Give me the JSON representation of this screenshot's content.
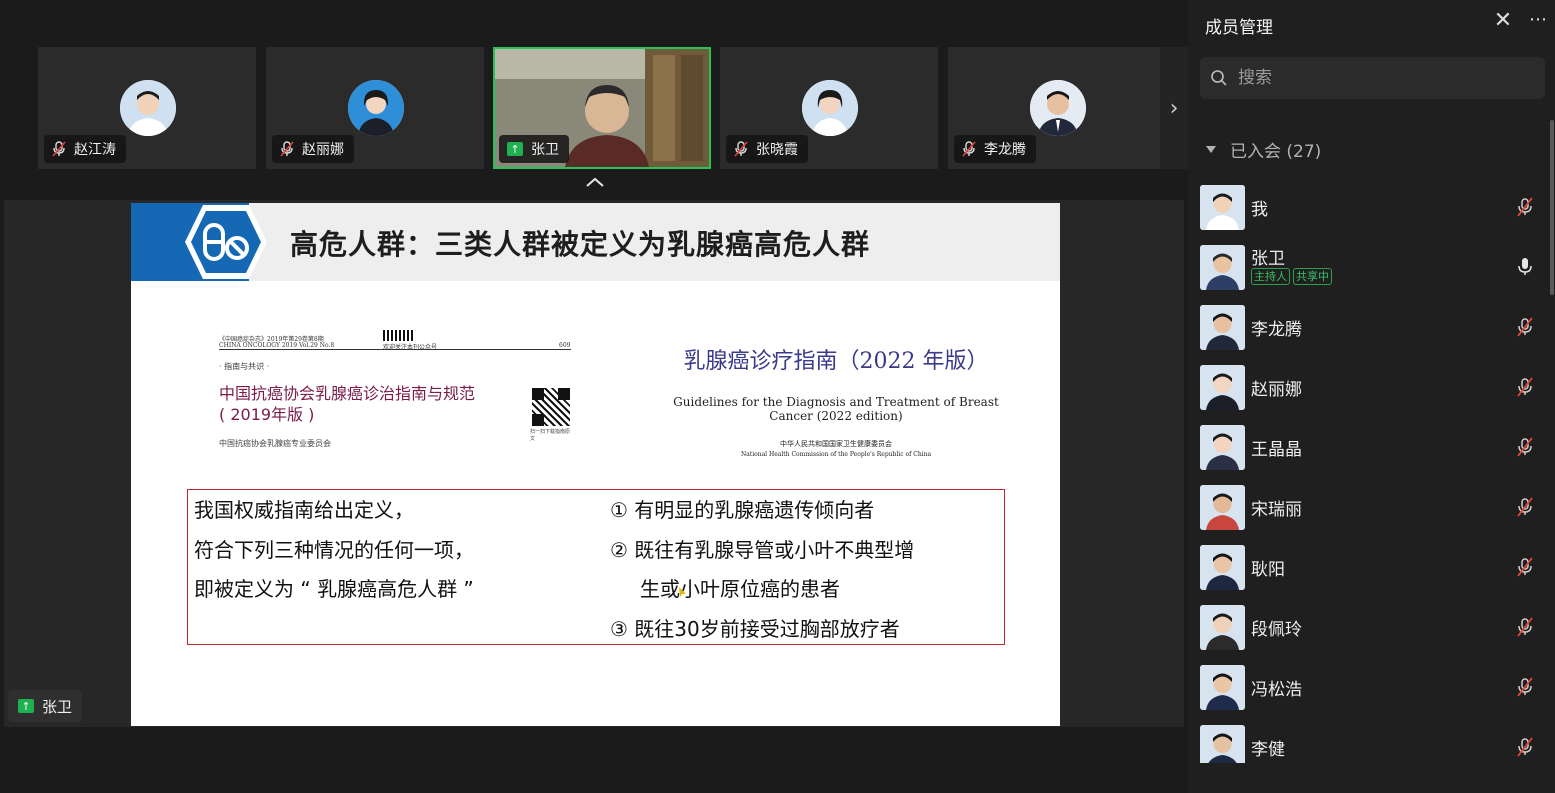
{
  "panel": {
    "title": "成员管理",
    "search_placeholder": "搜索",
    "group_label": "已入会 (27)",
    "members": [
      {
        "name": "我",
        "muted": true,
        "skin": "#f0d2b8",
        "shirt": "#ffffff",
        "hair": "#1a1a1a"
      },
      {
        "name": "张卫",
        "muted": false,
        "tags": [
          "主持人",
          "共享中"
        ],
        "skin": "#e8c3a2",
        "shirt": "#2d3f66",
        "hair": "#2a2a2a"
      },
      {
        "name": "李龙腾",
        "muted": true,
        "skin": "#e6c0a0",
        "shirt": "#20283a",
        "hair": "#151515"
      },
      {
        "name": "赵丽娜",
        "muted": true,
        "skin": "#f3d6c2",
        "shirt": "#1c1f2a",
        "hair": "#1a1a1a"
      },
      {
        "name": "王晶晶",
        "muted": true,
        "skin": "#f2d4c0",
        "shirt": "#2a2f45",
        "hair": "#1a1a1a"
      },
      {
        "name": "宋瑞丽",
        "muted": true,
        "skin": "#e2b899",
        "shirt": "#c8463e",
        "hair": "#1a1a1a"
      },
      {
        "name": "耿阳",
        "muted": true,
        "skin": "#e8c5a6",
        "shirt": "#1d2740",
        "hair": "#121212"
      },
      {
        "name": "段佩玲",
        "muted": true,
        "skin": "#f0d0b8",
        "shirt": "#2b2b2b",
        "hair": "#1a1a1a"
      },
      {
        "name": "冯松浩",
        "muted": true,
        "skin": "#e8c6a6",
        "shirt": "#1f2b4a",
        "hair": "#121212"
      },
      {
        "name": "李健",
        "muted": true,
        "skin": "#e5c2a2",
        "shirt": "#1e2a44",
        "hair": "#151515"
      }
    ]
  },
  "video_strip": [
    {
      "name": "赵江涛",
      "muted": true,
      "skin": "#f0d2b8",
      "shirt": "#ffffff"
    },
    {
      "name": "赵丽娜",
      "muted": true,
      "skin": "#f3d6c2",
      "shirt": "#1c1f2a"
    },
    {
      "name": "张卫",
      "sharing": true,
      "active": true
    },
    {
      "name": "张晓霞",
      "muted": true,
      "skin": "#f2d4c0",
      "shirt": "#ffffff"
    },
    {
      "name": "李龙腾",
      "muted": true,
      "skin": "#e6c0a0",
      "shirt": "#20283a"
    }
  ],
  "slide": {
    "title": "高危人群：三类人群被定义为乳腺癌高危人群",
    "left_doc": {
      "header_small": "《中国癌症杂志》2019年第29卷第8期",
      "header_small_en": "CHINA ONCOLOGY 2019 Vol.29 No.8",
      "page_no": "609",
      "follow_text": "欢迎关注本刊公众号",
      "section": "· 指南与共识 ·",
      "title_line1": "中国抗癌协会乳腺癌诊治指南与规范",
      "title_line2": "( 2019年版 )",
      "org": "中国抗癌协会乳腺癌专业委员会",
      "qr_caption": "扫一扫下载指南原文"
    },
    "right_doc": {
      "title_cn": "乳腺癌诊疗指南（2022 年版）",
      "title_en": "Guidelines for the Diagnosis and Treatment of  Breast Cancer (2022 edition)",
      "org_cn": "中华人民共和国国家卫生健康委员会",
      "org_en": "National Health Commission of the People's Republic of China"
    },
    "definition": {
      "left_lines": [
        "我国权威指南给出定义，",
        "符合下列三种情况的任何一项，",
        "即被定义为 “ 乳腺癌高危人群 ”"
      ],
      "right_lines": [
        "① 有明显的乳腺癌遗传倾向者",
        "② 既往有乳腺导管或小叶不典型增",
        "生或小叶原位癌的患者",
        "③ 既往30岁前接受过胸部放疗者"
      ]
    }
  },
  "presenter_tag": "张卫",
  "colors": {
    "accent_green": "#26c25a",
    "slide_blue": "#1569b4",
    "box_red": "#c4232a",
    "muted_red": "#e0443a"
  }
}
